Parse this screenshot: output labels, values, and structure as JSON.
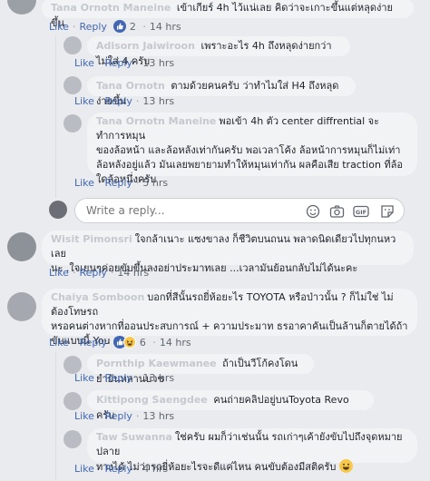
{
  "comments": [
    {
      "id": "c1",
      "name": "Tana Ornotn Maneine",
      "text": "เข้าเกียร์ 4h ไว้แน่เลย คิดว่าจะเกาะขึ้นแต่หลุดง่ายขึ้น",
      "like": "Like",
      "reply": "Reply",
      "reactions": "2",
      "time": "14 hrs"
    },
    {
      "id": "r1",
      "name": "Adisorn Jaiwiroon",
      "text": "เพราะอะไร 4h ถึงหลุดง่ายกว่าไม่ใส่ 4 ครับ",
      "like": "Like",
      "reply": "Reply",
      "time": "13 hrs"
    },
    {
      "id": "r2",
      "name": "Tana Ornotn",
      "text": "ตามด้วยคนครับ ว่าทำไมใส่ H4 ถึงหลุดง่ายขึ้น",
      "like": "Like",
      "reply": "Reply",
      "time": "13 hrs"
    },
    {
      "id": "r3",
      "name": "Tana Ornotn Maneine",
      "lines": [
        "พอเข้า 4h ตัว center diffrential จะทำการหมุน",
        "ของล้อหน้า และล้อหลังเท่ากันครับ พอเวลาโค้ง ล้อหน้าการหมุนก็ไม่เท่า",
        "ล้อหลังอยู่แล้ว มันเลยพยายามทำให้หมุนเท่ากัน ผลคือเสีย traction ที่ล้อ",
        "ใดล้อหนึ่งครับ"
      ],
      "like": "Like",
      "reply": "Reply",
      "time": "5 hrs"
    },
    {
      "id": "c2",
      "name": "Wisit Pimonsri",
      "lines": [
        "ใจกล้าเนาะ แซงขาลง ก็ชีวิตบนถนน พลาดนิดเดียวไปทุกนหวเลย",
        "นะ .ใจเยนๆค่อยขับขึ้นลงอย่าประมาทเลย ...เวลามันย้อนกลับไม่ได้นะคะ"
      ],
      "like": "Like",
      "reply": "Reply",
      "time": "14 hrs"
    },
    {
      "id": "c3",
      "name": "Chaiya Somboon",
      "lines": [
        "บอกที่สีนั้นรถยี่ห้อยะไร TOYOTA หรือป่าวนั้น ? ก็ไม่ใช่ ไม่ต้องโทษรถ",
        "หรอคนต่างหากที่ออนประสบการณ์ + ความประมาท ธรอาคาคันเป็นล้านก็ตายได้ถ้า",
        "ขับแบบนี้ You Ok?"
      ],
      "like": "Like",
      "reply": "Reply",
      "reactions": "6",
      "time": "14 hrs"
    },
    {
      "id": "r4",
      "name": "Pornthip Kaewmanee",
      "text": "ถ้าเป็นวีโก้คงโดนยำยันหลานบวช",
      "like": "Like",
      "reply": "Reply",
      "time": "13 hrs"
    },
    {
      "id": "r5",
      "name": "Kittipong Saengdee",
      "text": "คนถ่ายคลิปอยู่บนToyota Revo ครับ",
      "like": "Like",
      "reply": "Reply",
      "time": "13 hrs"
    },
    {
      "id": "r6",
      "name": "Taw Suwanna",
      "lines": [
        "ใช่ครับ ผมก็ว่าเช่นนั้น รถเก่าๆเค้ายังขับไปถึงจุดหมายปลาย",
        "ทางได้ ไม่ว่ารถยี่ห้อยะไรจะดีแค่ไหน คนขับต้องมีสติครับ"
      ],
      "like": "Like",
      "reply": "Reply",
      "time": "4 hrs"
    }
  ],
  "reply_box": {
    "placeholder": "Write a reply..."
  },
  "icons": {
    "emoji": "smiley-icon",
    "camera": "camera-icon",
    "gif": "gif-icon",
    "sticker": "sticker-icon",
    "like_badge": "thumbs-up-icon",
    "haha_badge": "haha-icon"
  },
  "colors": {
    "link": "#4267b2",
    "bubble": "#f2f3f5",
    "meta": "#606770",
    "background": "#e9ebee"
  }
}
